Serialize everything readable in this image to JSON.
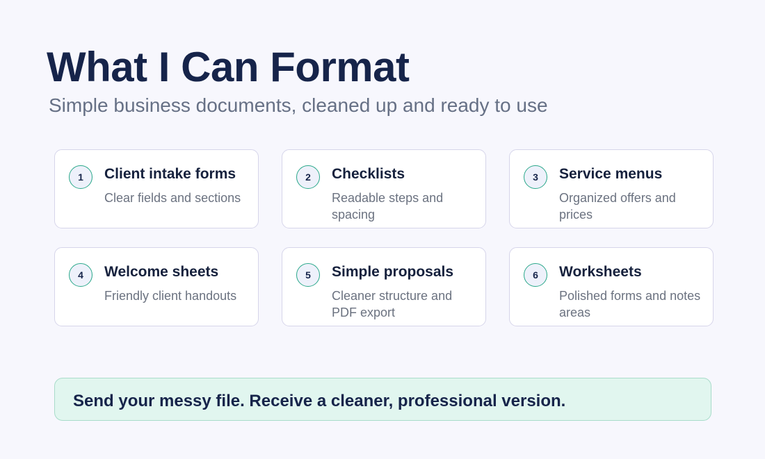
{
  "header": {
    "title": "What I Can Format",
    "subtitle": "Simple business documents, cleaned up and ready to use"
  },
  "cards": [
    {
      "number": "1",
      "title": "Client intake forms",
      "desc": "Clear fields and sections"
    },
    {
      "number": "2",
      "title": "Checklists",
      "desc": "Readable steps and spacing"
    },
    {
      "number": "3",
      "title": "Service menus",
      "desc": "Organized offers and prices"
    },
    {
      "number": "4",
      "title": "Welcome sheets",
      "desc": "Friendly client handouts"
    },
    {
      "number": "5",
      "title": "Simple proposals",
      "desc": "Cleaner structure and PDF export"
    },
    {
      "number": "6",
      "title": "Worksheets",
      "desc": "Polished forms and notes areas"
    }
  ],
  "banner": {
    "text": "Send your messy file. Receive a cleaner, professional version."
  },
  "colors": {
    "title": "#16244a",
    "accent": "#2aa88a",
    "banner_bg": "#e1f6ef"
  }
}
